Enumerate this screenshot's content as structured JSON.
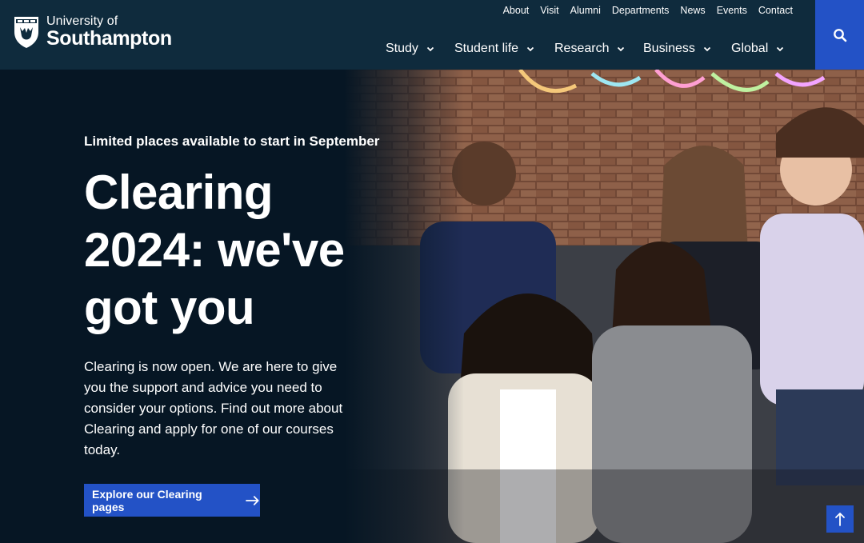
{
  "header": {
    "logo": {
      "line1": "University of",
      "line2": "Southampton",
      "icon": "university-crest-icon"
    },
    "utility_nav": [
      "About",
      "Visit",
      "Alumni",
      "Departments",
      "News",
      "Events",
      "Contact"
    ],
    "main_nav": [
      "Study",
      "Student life",
      "Research",
      "Business",
      "Global"
    ],
    "search_icon": "search-icon"
  },
  "hero": {
    "eyebrow": "Limited places available to start in September",
    "title_lines": [
      "Clearing",
      "2024: we've",
      "got you"
    ],
    "intro": "Clearing is now open. We are here to give you the support and advice you need to consider your options. Find out more about Clearing and apply for one of our courses today.",
    "cta_label": "Explore our Clearing pages",
    "cta_icon": "arrow-right-icon",
    "back_to_top_icon": "arrow-up-icon"
  },
  "colors": {
    "header_bg": "#0f2b3d",
    "hero_bg": "#061624",
    "accent": "#2352c6"
  }
}
